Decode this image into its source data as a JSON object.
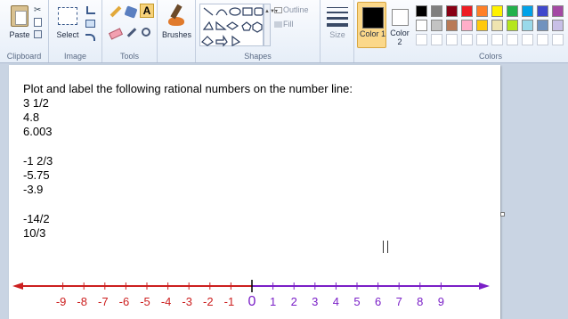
{
  "ribbon": {
    "clipboard": {
      "paste_label": "Paste",
      "group_label": "Clipboard"
    },
    "image": {
      "select_label": "Select",
      "group_label": "Image"
    },
    "tools": {
      "group_label": "Tools",
      "text_tool": "A"
    },
    "brushes": {
      "label": "Brushes"
    },
    "shapes": {
      "group_label": "Shapes",
      "outline_label": "Outline",
      "fill_label": "Fill"
    },
    "size": {
      "label": "Size"
    },
    "color1": {
      "label": "Color 1",
      "value": "#000000"
    },
    "color2": {
      "label": "Color 2",
      "value": "#ffffff"
    },
    "colors": {
      "group_label": "Colors",
      "row1": [
        "#000000",
        "#7f7f7f",
        "#880015",
        "#ed1c24",
        "#ff7f27",
        "#fff200",
        "#22b14c",
        "#00a2e8",
        "#3f48cc",
        "#a349a4"
      ],
      "row2": [
        "#ffffff",
        "#c3c3c3",
        "#b97a57",
        "#ffaec9",
        "#ffc90e",
        "#efe4b0",
        "#b5e61d",
        "#99d9ea",
        "#7092be",
        "#c8bfe7"
      ]
    }
  },
  "document": {
    "heading": "Plot and label the following rational numbers on the number line:",
    "group1": [
      "3 1/2",
      "4.8",
      "6.003"
    ],
    "group2": [
      "-1 2/3",
      "-5.75",
      "-3.9"
    ],
    "group3": [
      "-14/2",
      "10/3"
    ]
  },
  "number_line": {
    "negative_labels": [
      "-9",
      "-8",
      "-7",
      "-6",
      "-5",
      "-4",
      "-3",
      "-2",
      "-1"
    ],
    "zero_label": "0",
    "positive_labels": [
      "1",
      "2",
      "3",
      "4",
      "5",
      "6",
      "7",
      "8",
      "9"
    ],
    "negative_color": "#cc1f1f",
    "positive_color": "#7a1fc7"
  }
}
